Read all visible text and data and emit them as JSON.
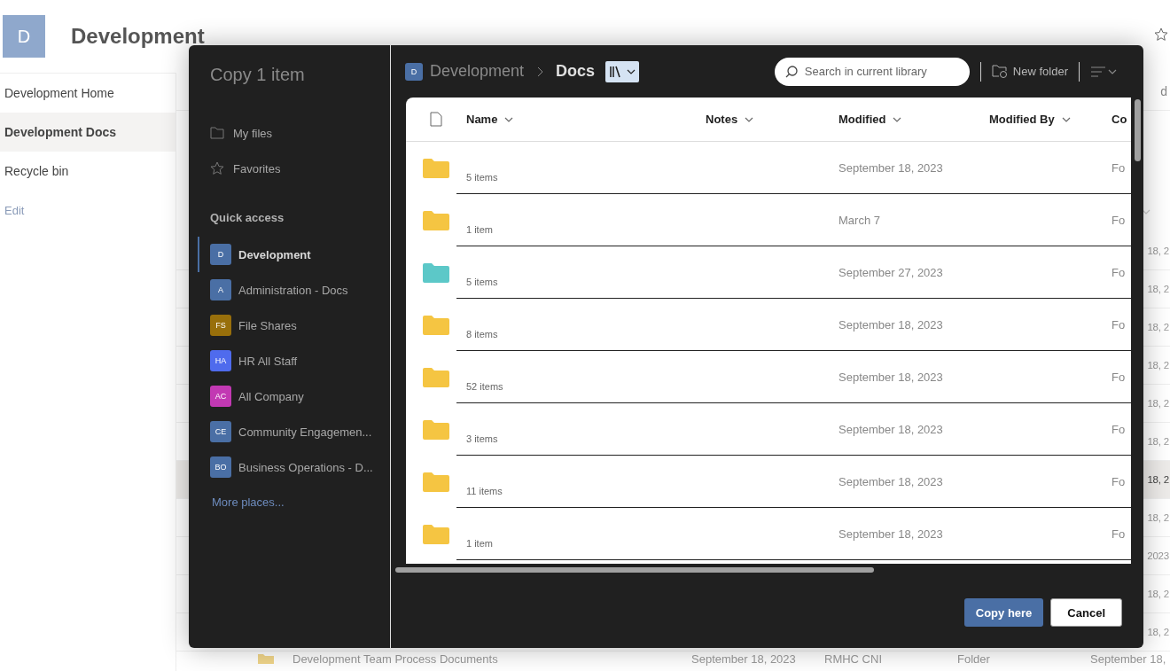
{
  "site": {
    "initial": "D",
    "title": "Development"
  },
  "nav": [
    {
      "label": "Development Home",
      "selected": false
    },
    {
      "label": "Development Docs",
      "selected": true
    },
    {
      "label": "Recycle bin",
      "selected": false
    }
  ],
  "nav_edit": "Edit",
  "background_list": {
    "header_fragment": "d",
    "rows": [
      {
        "fragment": "18, 2",
        "selected": false
      },
      {
        "fragment": "18, 2",
        "selected": false
      },
      {
        "fragment": "18, 2",
        "selected": false
      },
      {
        "fragment": "18, 2",
        "selected": false
      },
      {
        "fragment": "18, 2",
        "selected": false
      },
      {
        "fragment": "18, 2",
        "selected": false
      },
      {
        "fragment": "18, 2",
        "selected": true
      },
      {
        "fragment": "18, 2",
        "selected": false
      },
      {
        "fragment": "2023",
        "selected": false
      },
      {
        "fragment": "18, 2",
        "selected": false
      },
      {
        "fragment": "18, 2",
        "selected": false
      }
    ],
    "last_row": {
      "name": "Development Team Process Documents",
      "modified": "September 18, 2023",
      "modified_by": "RMHC CNI",
      "type": "Folder",
      "date": "September 18,"
    }
  },
  "dialog": {
    "title": "Copy 1 item",
    "places": [
      {
        "label": "My files",
        "kind": "folder"
      },
      {
        "label": "Favorites",
        "kind": "star"
      }
    ],
    "quick_access_title": "Quick access",
    "quick_access": [
      {
        "initials": "D",
        "label": "Development",
        "color": "#4a6fa5",
        "selected": true
      },
      {
        "initials": "A",
        "label": "Administration - Docs",
        "color": "#4a6fa5",
        "selected": false
      },
      {
        "initials": "FS",
        "label": "File Shares",
        "color": "#986f0b",
        "selected": false
      },
      {
        "initials": "HA",
        "label": "HR All Staff",
        "color": "#4f6bed",
        "selected": false
      },
      {
        "initials": "AC",
        "label": "All Company",
        "color": "#c239b3",
        "selected": false
      },
      {
        "initials": "CE",
        "label": "Community Engagemen...",
        "color": "#4a6fa5",
        "selected": false
      },
      {
        "initials": "BO",
        "label": "Business Operations - D...",
        "color": "#4a6fa5",
        "selected": false
      }
    ],
    "more_places": "More places...",
    "breadcrumb": {
      "site_initial": "D",
      "site": "Development",
      "library": "Docs"
    },
    "search": {
      "placeholder": "Search in current library"
    },
    "new_folder": "New folder",
    "columns": [
      "Name",
      "Notes",
      "Modified",
      "Modified By",
      "Co"
    ],
    "rows": [
      {
        "count": "5 items",
        "modified": "September 18, 2023",
        "type": "Fo",
        "color": "#f5c542"
      },
      {
        "count": "1 item",
        "modified": "March 7",
        "type": "Fo",
        "color": "#f5c542"
      },
      {
        "count": "5 items",
        "modified": "September 27, 2023",
        "type": "Fo",
        "color": "#5cc8c8"
      },
      {
        "count": "8 items",
        "modified": "September 18, 2023",
        "type": "Fo",
        "color": "#f5c542"
      },
      {
        "count": "52 items",
        "modified": "September 18, 2023",
        "type": "Fo",
        "color": "#f5c542"
      },
      {
        "count": "3 items",
        "modified": "September 18, 2023",
        "type": "Fo",
        "color": "#f5c542"
      },
      {
        "count": "11 items",
        "modified": "September 18, 2023",
        "type": "Fo",
        "color": "#f5c542"
      },
      {
        "count": "1 item",
        "modified": "September 18, 2023",
        "type": "Fo",
        "color": "#f5c542"
      }
    ],
    "buttons": {
      "primary": "Copy here",
      "secondary": "Cancel"
    }
  }
}
